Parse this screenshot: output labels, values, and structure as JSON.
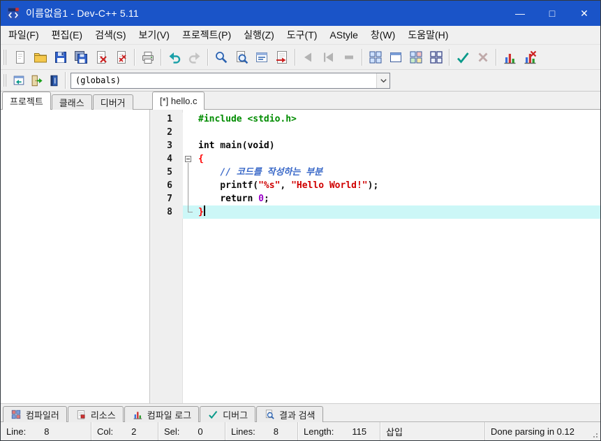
{
  "chrome": {
    "titlebar": "#1a54c8",
    "titlebar_text": "#ffffff",
    "ui_bg": "#f0f0f0"
  },
  "titlebar": {
    "title": "이름없음1 - Dev-C++ 5.11",
    "controls": [
      {
        "name": "minimize-button",
        "glyph": "—"
      },
      {
        "name": "maximize-button",
        "glyph": "□"
      },
      {
        "name": "close-button",
        "glyph": "✕"
      }
    ]
  },
  "menu": {
    "items": [
      "파일(F)",
      "편집(E)",
      "검색(S)",
      "보기(V)",
      "프로젝트(P)",
      "실행(Z)",
      "도구(T)",
      "AStyle",
      "창(W)",
      "도움말(H)"
    ]
  },
  "toolbar_main": {
    "groups": [
      {
        "icons": [
          {
            "name": "new-file-icon",
            "kind": "page"
          },
          {
            "name": "open-file-icon",
            "kind": "folder"
          },
          {
            "name": "save-icon",
            "kind": "floppy"
          },
          {
            "name": "save-all-icon",
            "kind": "floppy2"
          },
          {
            "name": "close-file-icon",
            "kind": "pagex"
          },
          {
            "name": "close-all-icon",
            "kind": "pagexx"
          }
        ]
      },
      {
        "icons": [
          {
            "name": "print-icon",
            "kind": "printer"
          }
        ]
      },
      {
        "icons": [
          {
            "name": "undo-icon",
            "kind": "undo"
          },
          {
            "name": "redo-icon",
            "kind": "redo",
            "disabled": true
          }
        ]
      },
      {
        "icons": [
          {
            "name": "find-icon",
            "kind": "magnifier"
          },
          {
            "name": "find-in-files-icon",
            "kind": "magpage"
          },
          {
            "name": "replace-icon",
            "kind": "replace"
          },
          {
            "name": "goto-line-icon",
            "kind": "gotoline"
          }
        ]
      },
      {
        "icons": [
          {
            "name": "step-over-icon",
            "kind": "trileft",
            "disabled": true
          },
          {
            "name": "next-breakpoint-icon",
            "kind": "trileftbar",
            "disabled": true
          },
          {
            "name": "stop-execution-icon",
            "kind": "dash",
            "disabled": true
          }
        ]
      },
      {
        "icons": [
          {
            "name": "compile-icon",
            "kind": "grid4",
            "colors": [
              "#cfe2ff",
              "#cfe2ff",
              "#cfe2ff",
              "#cfe2ff"
            ]
          },
          {
            "name": "run-icon",
            "kind": "window"
          },
          {
            "name": "compile-run-icon",
            "kind": "grid4",
            "colors": [
              "#cfe2ff",
              "#f6c2c2",
              "#c9ecc9",
              "#f7e9a8"
            ]
          },
          {
            "name": "rebuild-all-icon",
            "kind": "grid4o"
          }
        ]
      },
      {
        "icons": [
          {
            "name": "syntax-check-icon",
            "kind": "check"
          },
          {
            "name": "abort-compile-icon",
            "kind": "cross",
            "disabled": true
          }
        ]
      },
      {
        "icons": [
          {
            "name": "profile-icon",
            "kind": "chart"
          },
          {
            "name": "profile-delete-icon",
            "kind": "chartx"
          }
        ]
      }
    ]
  },
  "toolbar_specials": {
    "icons": [
      {
        "name": "toggle-explorer-icon",
        "kind": "winback"
      },
      {
        "name": "goto-function-icon",
        "kind": "door"
      },
      {
        "name": "class-browser-icon",
        "kind": "book"
      }
    ],
    "class_browser": {
      "value": "(globals)"
    }
  },
  "left_tabs": {
    "items": [
      {
        "label": "프로젝트",
        "active": true
      },
      {
        "label": "클래스",
        "active": false
      },
      {
        "label": "디버거",
        "active": false
      }
    ]
  },
  "editor_tabs": {
    "items": [
      {
        "label": "[*] hello.c",
        "active": true
      }
    ]
  },
  "editor": {
    "colors": {
      "current_line": "#ccf7f7",
      "preprocessor": "#008c00",
      "string": "#d00000",
      "comment": "#3968c8",
      "brace": "#ff0000",
      "number": "#9a00c8",
      "plain": "#000000"
    },
    "lines": [
      {
        "num": "1",
        "fold": null,
        "segments": [
          {
            "t": "#include <stdio.h>",
            "c": "pp"
          }
        ]
      },
      {
        "num": "2",
        "fold": null,
        "segments": []
      },
      {
        "num": "3",
        "fold": null,
        "segments": [
          {
            "t": "int",
            "c": "k"
          },
          {
            "t": " main(",
            "c": "p"
          },
          {
            "t": "void",
            "c": "k"
          },
          {
            "t": ")",
            "c": "p"
          }
        ]
      },
      {
        "num": "4",
        "fold": "open",
        "segments": [
          {
            "t": "{",
            "c": "b"
          }
        ]
      },
      {
        "num": "5",
        "fold": "bar",
        "segments": [
          {
            "t": "    ",
            "c": "p"
          },
          {
            "t": "// 코드를 작성하는 부분",
            "c": "c"
          }
        ]
      },
      {
        "num": "6",
        "fold": "bar",
        "segments": [
          {
            "t": "    printf(",
            "c": "p"
          },
          {
            "t": "\"%s\"",
            "c": "s"
          },
          {
            "t": ", ",
            "c": "p"
          },
          {
            "t": "\"Hello World!\"",
            "c": "s"
          },
          {
            "t": ");",
            "c": "p"
          }
        ]
      },
      {
        "num": "7",
        "fold": "bar",
        "segments": [
          {
            "t": "    ",
            "c": "p"
          },
          {
            "t": "return",
            "c": "k"
          },
          {
            "t": " ",
            "c": "p"
          },
          {
            "t": "0",
            "c": "n"
          },
          {
            "t": ";",
            "c": "p"
          }
        ]
      },
      {
        "num": "8",
        "fold": "end",
        "current": true,
        "caret": true,
        "segments": [
          {
            "t": "}",
            "c": "b"
          }
        ]
      }
    ]
  },
  "bottom_tabs": {
    "items": [
      {
        "name": "tab-compiler",
        "label": "컴파일러",
        "icon": {
          "name": "compiler-icon",
          "kind": "grid4",
          "colors": [
            "#e07878",
            "#7e9cd8",
            "#7e9cd8",
            "#e07878"
          ]
        }
      },
      {
        "name": "tab-resources",
        "label": "리소스",
        "icon": {
          "name": "resources-icon",
          "kind": "respage"
        }
      },
      {
        "name": "tab-compile-log",
        "label": "컴파일 로그",
        "icon": {
          "name": "compile-log-icon",
          "kind": "chart"
        }
      },
      {
        "name": "tab-debug",
        "label": "디버그",
        "icon": {
          "name": "debug-icon",
          "kind": "check"
        }
      },
      {
        "name": "tab-search-results",
        "label": "결과 검색",
        "icon": {
          "name": "search-results-icon",
          "kind": "magpage"
        }
      }
    ]
  },
  "statusbar": {
    "segments": [
      {
        "name": "status-line",
        "label": "Line:",
        "value": "8"
      },
      {
        "name": "status-col",
        "label": "Col:",
        "value": "2"
      },
      {
        "name": "status-sel",
        "label": "Sel:",
        "value": "0"
      },
      {
        "name": "status-lines",
        "label": "Lines:",
        "value": "8"
      },
      {
        "name": "status-length",
        "label": "Length:",
        "value": "115"
      },
      {
        "name": "status-insert-mode",
        "label": "삽입",
        "value": ""
      },
      {
        "name": "status-parse",
        "label": "Done parsing in 0.12",
        "value": ""
      }
    ]
  }
}
